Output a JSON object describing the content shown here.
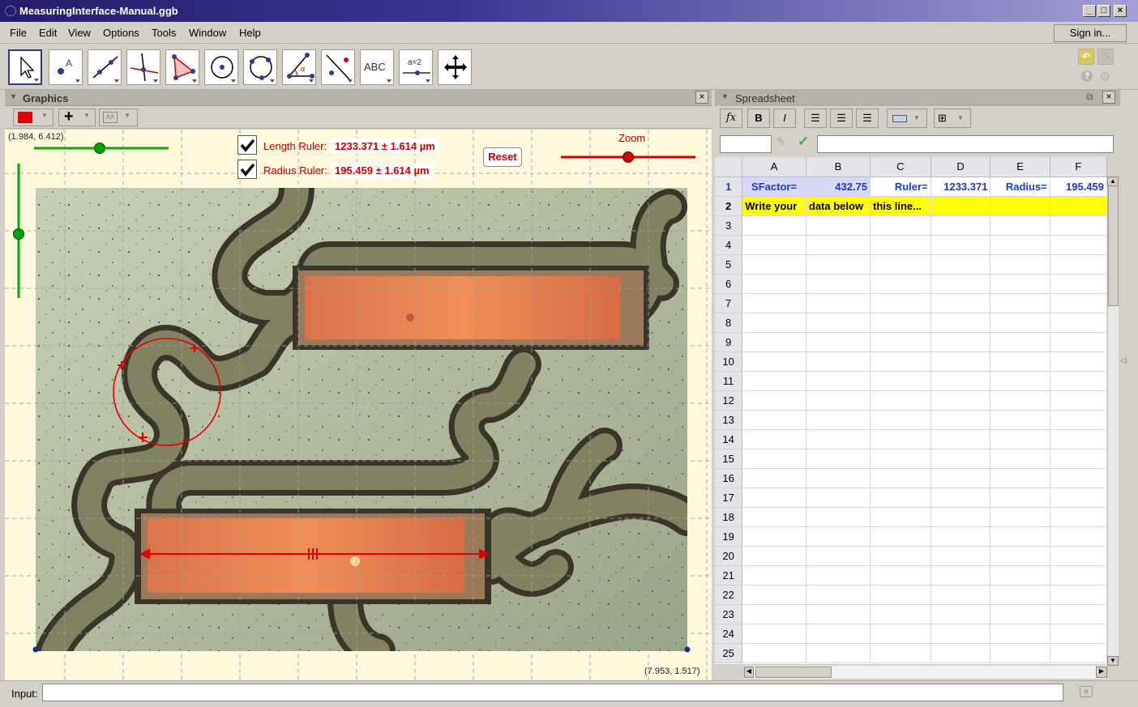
{
  "window": {
    "title": "MeasuringInterface-Manual.ggb",
    "minimize": "_",
    "maximize": "□",
    "close": "×"
  },
  "menu": {
    "items": [
      "File",
      "Edit",
      "View",
      "Options",
      "Tools",
      "Window",
      "Help"
    ],
    "sign_in": "Sign in..."
  },
  "toolbar": {
    "tools": [
      "move-tool",
      "point-tool",
      "line-tool",
      "perpendicular-line-tool",
      "polygon-tool",
      "circle-center-point-tool",
      "circle-three-points-tool",
      "angle-tool",
      "reflect-tool",
      "text-tool",
      "slider-tool",
      "move-graphics-view-tool"
    ],
    "text_tool_label": "ABC",
    "slider_tool_label": "a=2"
  },
  "graphics": {
    "title": "Graphics",
    "top_left_coord": "(1.984, 6.412)",
    "bottom_right_coord": "(7.953, 1.517)",
    "length_ruler_label": "Length Ruler:",
    "length_ruler_value": "1233.371 ± 1.614 µm",
    "radius_ruler_label": "Radius Ruler:",
    "radius_ruler_value": "195.459 ± 1.614 µm",
    "reset_label": "Reset",
    "zoom_label": "Zoom",
    "length_ruler_checked": true,
    "radius_ruler_checked": true
  },
  "spreadsheet": {
    "title": "Spreadsheet",
    "bold": "B",
    "italic": "I",
    "fx": "fx",
    "columns": [
      "A",
      "B",
      "C",
      "D",
      "E",
      "F"
    ],
    "row1": [
      "SFactor=",
      "432.75",
      "Ruler=",
      "1233.371",
      "Radius=",
      "195.459"
    ],
    "row2": [
      "Write your",
      "data below",
      "this line...",
      "",
      "",
      ""
    ],
    "row_numbers": [
      "1",
      "2",
      "3",
      "4",
      "5",
      "6",
      "7",
      "8",
      "9",
      "10",
      "11",
      "12",
      "13",
      "14",
      "15",
      "16",
      "17",
      "18",
      "19",
      "20",
      "21",
      "22",
      "23",
      "24",
      "25"
    ]
  },
  "input": {
    "label": "Input:",
    "value": ""
  },
  "colors": {
    "accent_red": "#e00000",
    "slider_green": "#00b000",
    "row1_text": "#1a3cc8",
    "row2_bg": "#ffff00",
    "row1_bg": "#d8d8f8"
  }
}
